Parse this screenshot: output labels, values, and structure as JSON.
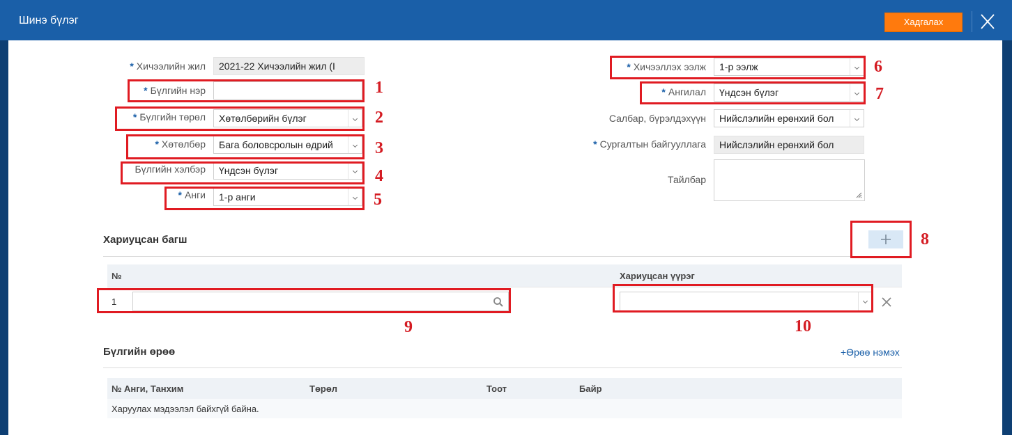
{
  "window": {
    "title": "Шинэ бүлэг",
    "save_label": "Хадгалах",
    "accent_color": "#1a5fa8",
    "save_color": "#ff7a0d"
  },
  "form_left": {
    "school_year": {
      "label": "Хичээлийн жил",
      "value": "2021-22 Хичээлийн жил (I"
    },
    "group_name": {
      "label": "Бүлгийн нэр",
      "value": ""
    },
    "group_type": {
      "label": "Бүлгийн төрөл",
      "value": "Хөтөлбөрийн бүлэг"
    },
    "program": {
      "label": "Хөтөлбөр",
      "value": "Бага боловсролын өдрий"
    },
    "group_form": {
      "label": "Бүлгийн хэлбэр",
      "value": "Үндсэн бүлэг"
    },
    "grade": {
      "label": "Анги",
      "value": "1-р анги"
    }
  },
  "form_right": {
    "shift": {
      "label": "Хичээллэх ээлж",
      "value": "1-р ээлж"
    },
    "category": {
      "label": "Ангилал",
      "value": "Үндсэн бүлэг"
    },
    "branch": {
      "label": "Салбар, бүрэлдэхүүн",
      "value": "Нийслэлийн ерөнхий бол"
    },
    "institution": {
      "label": "Сургалтын байгууллага",
      "value": "Нийслэлийн ерөнхий бол"
    },
    "note": {
      "label": "Тайлбар",
      "value": ""
    }
  },
  "teachers": {
    "title": "Хариуцсан багш",
    "columns": {
      "number": "№",
      "role": "Хариуцсан үүрэг"
    },
    "rows": [
      {
        "number": "1",
        "teacher": "",
        "role": ""
      }
    ]
  },
  "rooms": {
    "title": "Бүлгийн өрөө",
    "add_label": "+Өрөө нэмэх",
    "columns": {
      "number": "№",
      "class_room": "Анги, Танхим",
      "type": "Төрөл",
      "count": "Тоот",
      "building": "Байр"
    },
    "empty_message": "Харуулах мэдээлэл байхгүй байна."
  },
  "annotations": [
    "1",
    "2",
    "3",
    "4",
    "5",
    "6",
    "7",
    "8",
    "9",
    "10"
  ],
  "annotation_color": "#e01b22"
}
